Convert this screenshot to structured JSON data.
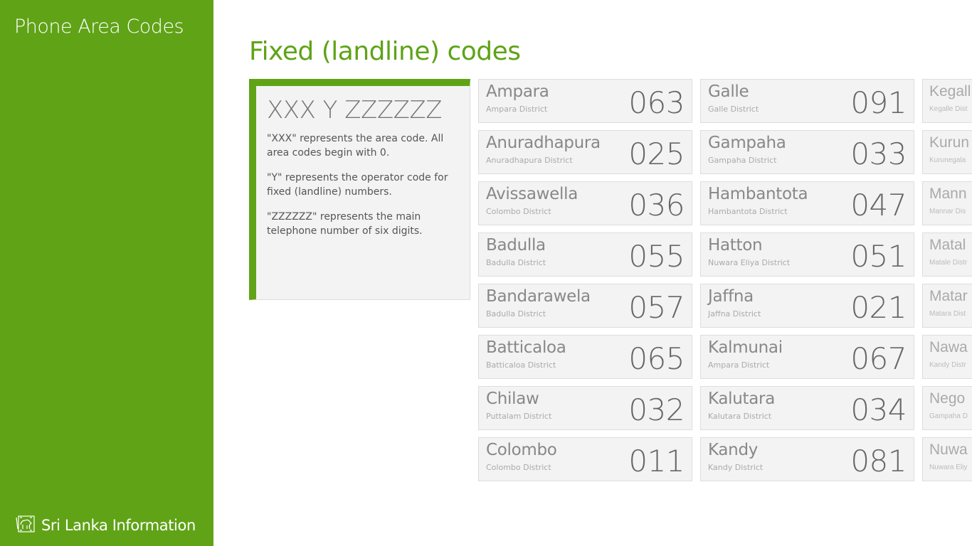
{
  "sidebar": {
    "app_title": "Phone Area Codes",
    "footer_label": "Sri Lanka Information",
    "footer_icon": "lion-flag-icon"
  },
  "page_title": "Fixed (landline) codes",
  "info": {
    "format": "XXX Y ZZZZZZ",
    "paragraphs": [
      "\"XXX\" represents the area code. All area codes begin with 0.",
      "\"Y\" represents the operator code for fixed (landline) numbers.",
      "\"ZZZZZZ\" represents the main telephone number of six digits."
    ]
  },
  "colors": {
    "accent": "#60a317"
  },
  "columns": [
    [
      {
        "name": "Ampara",
        "district": "Ampara District",
        "code": "063"
      },
      {
        "name": "Anuradhapura",
        "district": "Anuradhapura District",
        "code": "025"
      },
      {
        "name": "Avissawella",
        "district": "Colombo District",
        "code": "036"
      },
      {
        "name": "Badulla",
        "district": "Badulla District",
        "code": "055"
      },
      {
        "name": "Bandarawela",
        "district": "Badulla District",
        "code": "057"
      },
      {
        "name": "Batticaloa",
        "district": "Batticaloa District",
        "code": "065"
      },
      {
        "name": "Chilaw",
        "district": "Puttalam District",
        "code": "032"
      },
      {
        "name": "Colombo",
        "district": "Colombo District",
        "code": "011"
      }
    ],
    [
      {
        "name": "Galle",
        "district": "Galle District",
        "code": "091"
      },
      {
        "name": "Gampaha",
        "district": "Gampaha District",
        "code": "033"
      },
      {
        "name": "Hambantota",
        "district": "Hambantota District",
        "code": "047"
      },
      {
        "name": "Hatton",
        "district": "Nuwara Eliya District",
        "code": "051"
      },
      {
        "name": "Jaffna",
        "district": "Jaffna District",
        "code": "021"
      },
      {
        "name": "Kalmunai",
        "district": "Ampara District",
        "code": "067"
      },
      {
        "name": "Kalutara",
        "district": "Kalutara District",
        "code": "034"
      },
      {
        "name": "Kandy",
        "district": "Kandy District",
        "code": "081"
      }
    ],
    [
      {
        "name": "Kegall",
        "district": "Kegalle Dist"
      },
      {
        "name": "Kurun",
        "district": "Kurunegala"
      },
      {
        "name": "Mann",
        "district": "Mannar Dis"
      },
      {
        "name": "Matal",
        "district": "Matale Distr"
      },
      {
        "name": "Matar",
        "district": "Matara Dist"
      },
      {
        "name": "Nawa",
        "district": "Kandy Distr"
      },
      {
        "name": "Nego",
        "district": "Gampaha D"
      },
      {
        "name": "Nuwa",
        "district": "Nuwara Eliy"
      }
    ]
  ]
}
